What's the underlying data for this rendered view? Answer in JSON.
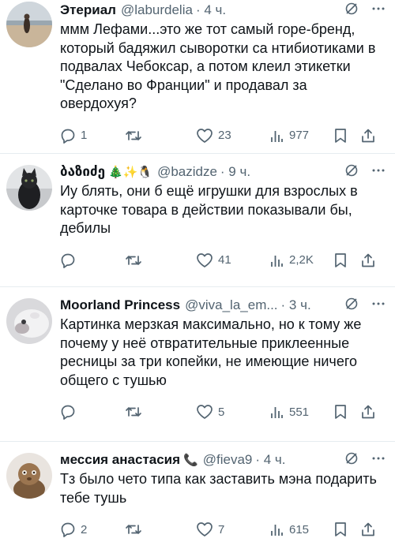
{
  "tweets": [
    {
      "name": "Этериал",
      "handle": "@laburdelia",
      "time": "· 4 ч.",
      "text": "ммм Лефами...это же тот самый горе-бренд, который бадяжил сыворотки са нтибиотиками в подвалах Чебоксар, а потом клеил этикетки \"Сделано во Франции\" и продавал за овердохуя?",
      "replies": "1",
      "retweets": "",
      "likes": "23",
      "views": "977"
    },
    {
      "name": "ბაზიძე",
      "emoji": "🎄✨🐧",
      "handle": "@bazidze",
      "time": "· 9 ч.",
      "text": "Иу блять, они б ещё игрушки для взрослых в карточке товара в действии показывали бы, дебилы",
      "replies": "",
      "retweets": "",
      "likes": "41",
      "views": "2,2K"
    },
    {
      "name": "Moorland Princess",
      "handle": "@viva_la_em...",
      "time": "· 3 ч.",
      "text": "Картинка мерзкая максимально, но к тому же почему у неё отвратительные приклеенные ресницы за три копейки, не имеющие ничего общего с тушью",
      "replies": "",
      "retweets": "",
      "likes": "5",
      "views": "551"
    },
    {
      "name": "мессия анастасия",
      "emoji": "📞",
      "handle": "@fieva9",
      "time": "· 4 ч.",
      "text": "Тз было чето типа как заставить мэна подарить тебе тушь",
      "replies": "2",
      "retweets": "",
      "likes": "7",
      "views": "615"
    }
  ],
  "icons": {
    "grok": "grok-icon",
    "more": "more-icon",
    "reply": "reply-icon",
    "retweet": "retweet-icon",
    "like": "like-icon",
    "views": "views-icon",
    "bookmark": "bookmark-icon",
    "share": "share-icon"
  },
  "colors": {
    "text": "#0f1419",
    "secondary": "#536471",
    "divider": "#e6ecf0"
  }
}
